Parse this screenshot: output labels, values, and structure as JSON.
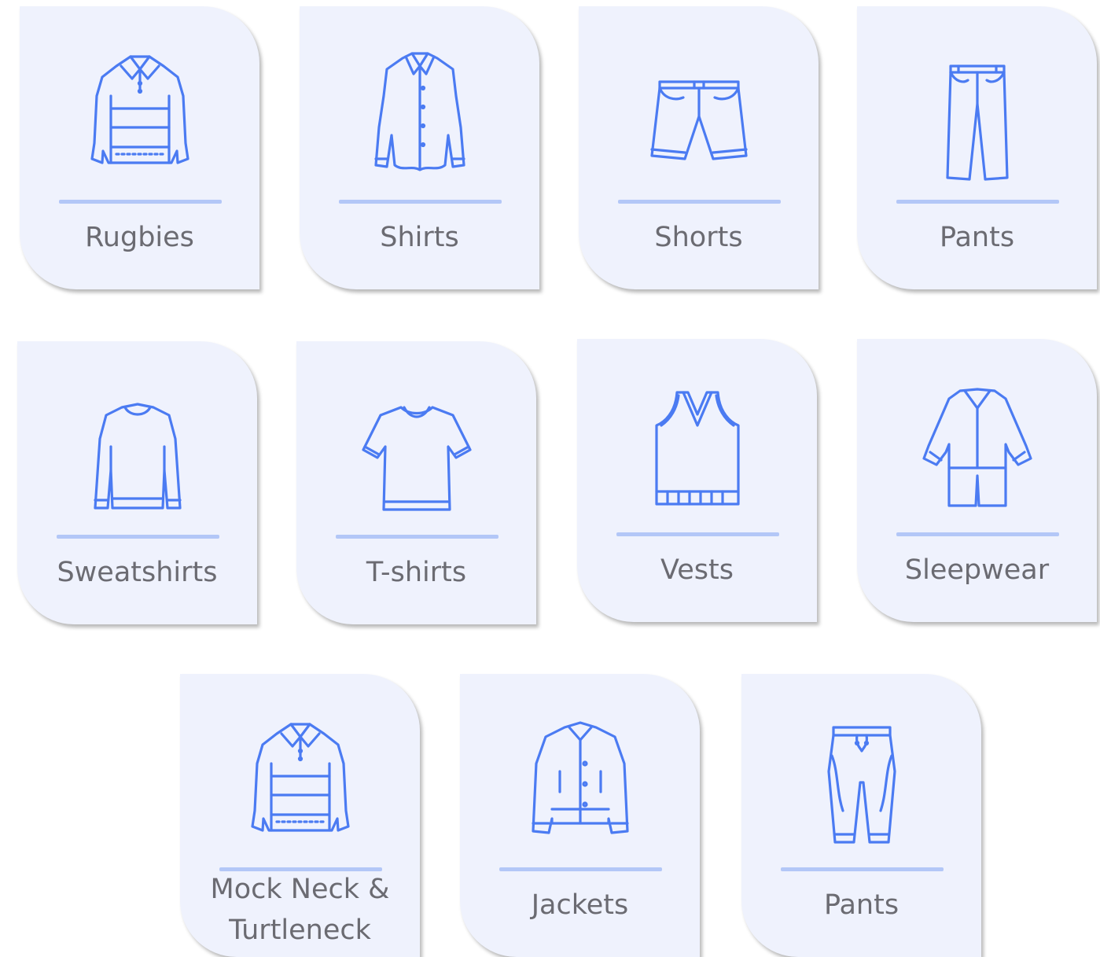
{
  "accent_color": "#4b7bf2",
  "divider_color": "#b3c7f7",
  "card_background": "#eff2fd",
  "categories": [
    {
      "label": "Rugbies",
      "icon": "rugby-shirt-icon"
    },
    {
      "label": "Shirts",
      "icon": "button-shirt-icon"
    },
    {
      "label": "Shorts",
      "icon": "shorts-icon"
    },
    {
      "label": "Pants",
      "icon": "pants-icon"
    },
    {
      "label": "Sweatshirts",
      "icon": "sweatshirt-icon"
    },
    {
      "label": "T-shirts",
      "icon": "t-shirt-icon"
    },
    {
      "label": "Vests",
      "icon": "vest-icon"
    },
    {
      "label": "Sleepwear",
      "icon": "pajamas-icon"
    },
    {
      "label": "Mock Neck & Turtleneck",
      "icon": "mock-neck-icon"
    },
    {
      "label": "Jackets",
      "icon": "jacket-icon"
    },
    {
      "label": "Pants",
      "icon": "jogger-pants-icon"
    }
  ]
}
